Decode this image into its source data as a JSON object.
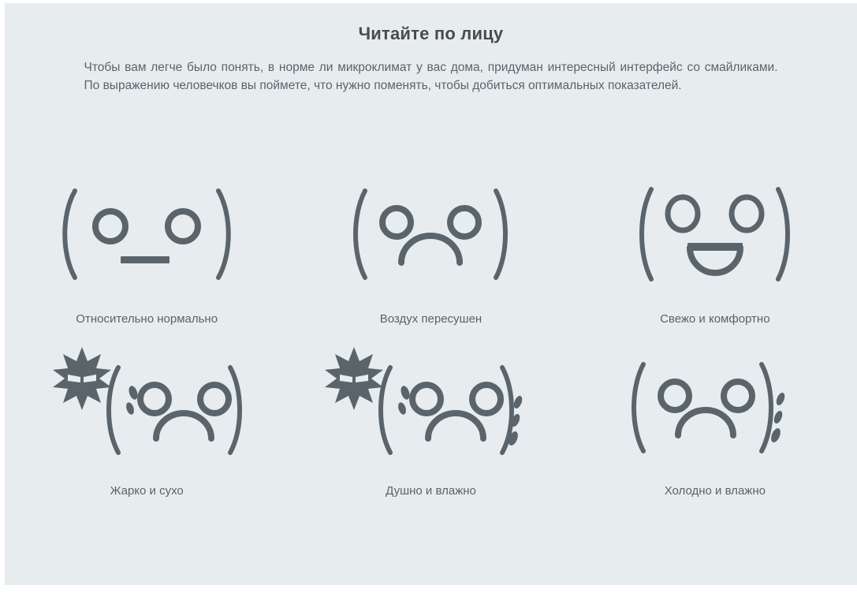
{
  "page": {
    "background_color": "#e7edef",
    "text_color": "#57646a",
    "face_color": "#5a656b",
    "title": "Читайте по лицу",
    "intro": "Чтобы вам легче было понять, в норме ли микроклимат у вас дома, придуман интересный интерфейс со смайликами. По выражению человечков вы поймете, что нужно поменять, чтобы добиться оптимальных показателей."
  },
  "faces": [
    {
      "id": "face-neutral",
      "icon_name": "neutral-face-emoticon",
      "ascii": "(°_°)",
      "mouth": "flat",
      "caption": "Относительно нормально"
    },
    {
      "id": "face-sad-dry",
      "icon_name": "sad-face-emoticon",
      "ascii": "(°︵°)",
      "mouth": "frown",
      "caption": "Воздух пересушен"
    },
    {
      "id": "face-happy",
      "icon_name": "happy-face-emoticon",
      "ascii": "(°▽°)",
      "mouth": "open-smile",
      "caption": "Свежо и комфортно"
    },
    {
      "id": "face-hot-dry",
      "icon_name": "hot-dry-face-emoticon",
      "ascii": "☀(°︵°)",
      "mouth": "frown",
      "caption": "Жарко и сухо"
    },
    {
      "id": "face-stuffy-humid",
      "icon_name": "stuffy-humid-face-emoticon",
      "ascii": "☀(°︵°);",
      "mouth": "frown",
      "caption": "Душно и влажно"
    },
    {
      "id": "face-cold-humid",
      "icon_name": "cold-humid-face-emoticon",
      "ascii": "(°︵°);",
      "mouth": "frown",
      "caption": "Холодно и влажно"
    }
  ]
}
